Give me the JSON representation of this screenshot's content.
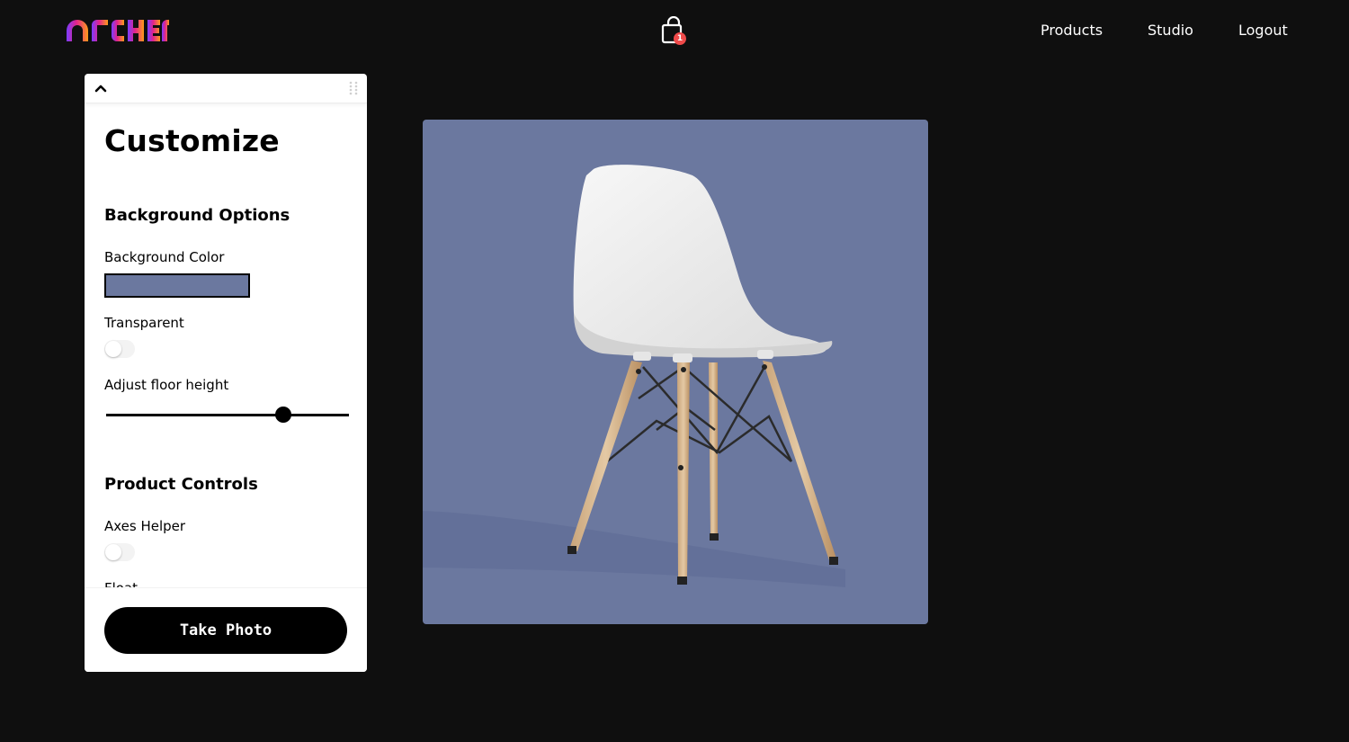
{
  "header": {
    "logo_text": "ARCHER",
    "cart_count": "1",
    "nav": [
      {
        "label": "Products"
      },
      {
        "label": "Studio"
      },
      {
        "label": "Logout"
      }
    ]
  },
  "panel": {
    "title": "Customize",
    "background_options": {
      "heading": "Background Options",
      "color_label": "Background Color",
      "color_value": "#6b789f",
      "transparent_label": "Transparent",
      "transparent_on": false,
      "floor_label": "Adjust floor height",
      "floor_value_fraction": 0.73
    },
    "product_controls": {
      "heading": "Product Controls",
      "axes_label": "Axes Helper",
      "axes_on": false,
      "float_label": "Float"
    },
    "take_photo_label": "Take Photo"
  },
  "colors": {
    "page_background": "#0f0f0f",
    "viewport_background": "#6b789f",
    "badge": "#ef4a4a"
  },
  "icons": {
    "cart": "shopping-bag-icon",
    "collapse": "chevron-up-icon",
    "drag": "drag-handle-icon"
  }
}
